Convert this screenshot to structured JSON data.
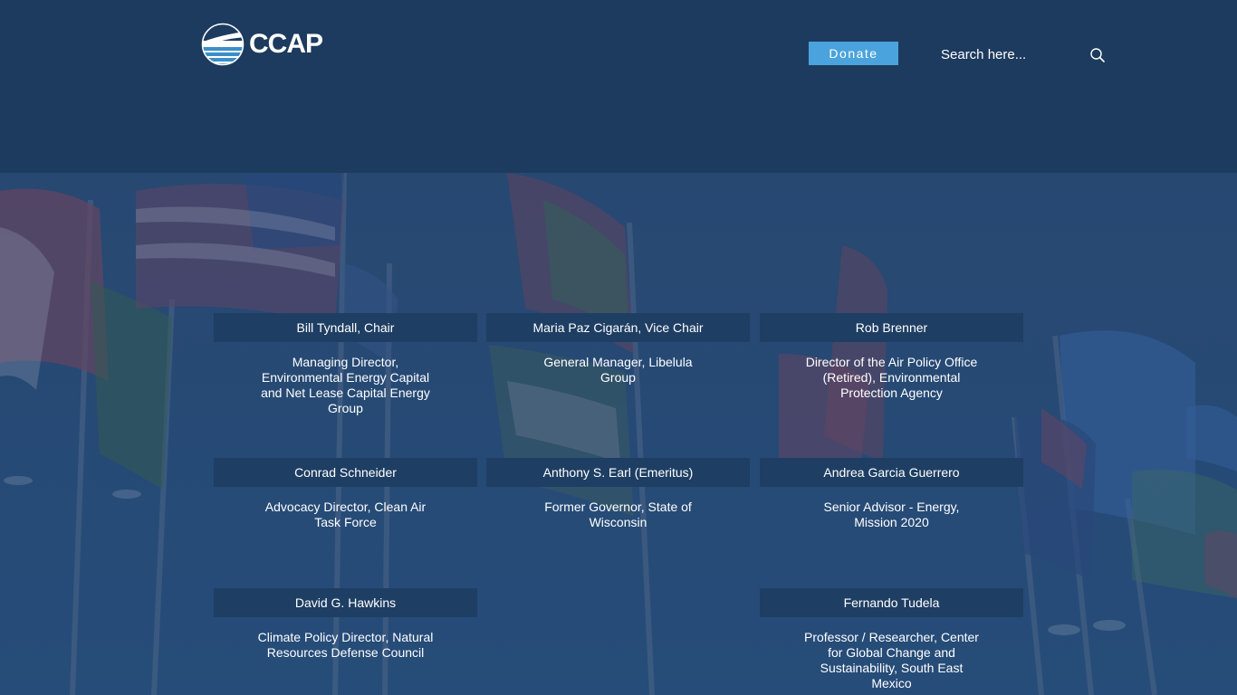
{
  "header": {
    "logo_text": "CCAP",
    "donate_label": "Donate",
    "search_placeholder": "Search here..."
  },
  "icons": {
    "search": "search-icon",
    "logo": "ccap-logo-icon"
  },
  "colors": {
    "header_bg": "#1d3b5e",
    "donate_bg": "#4aa3dc",
    "card_bg": "#1e3e63",
    "overlay": "#1f3d62"
  },
  "members": [
    {
      "name": "Bill Tyndall, Chair",
      "role": "Managing Director, Environmental Energy Capital and Net Lease Capital Energy Group"
    },
    {
      "name": "Maria Paz Cigarán, Vice Chair",
      "role": "General Manager, Libelula Group"
    },
    {
      "name": "Rob Brenner",
      "role": "Director of the Air Policy Office (Retired), Environmental Protection Agency"
    },
    {
      "name": "Conrad Schneider",
      "role": "Advocacy Director, Clean Air Task Force"
    },
    {
      "name": "Anthony S. Earl (Emeritus)",
      "role": "Former Governor, State of Wisconsin"
    },
    {
      "name": "Andrea Garcia Guerrero",
      "role": "Senior Advisor - Energy, Mission 2020"
    },
    {
      "name": "David G. Hawkins",
      "role": "Climate Policy Director, Natural Resources Defense Council"
    },
    {
      "name": "Fernando Tudela",
      "role": "Professor / Researcher, Center for Global Change and Sustainability, South East Mexico"
    }
  ]
}
